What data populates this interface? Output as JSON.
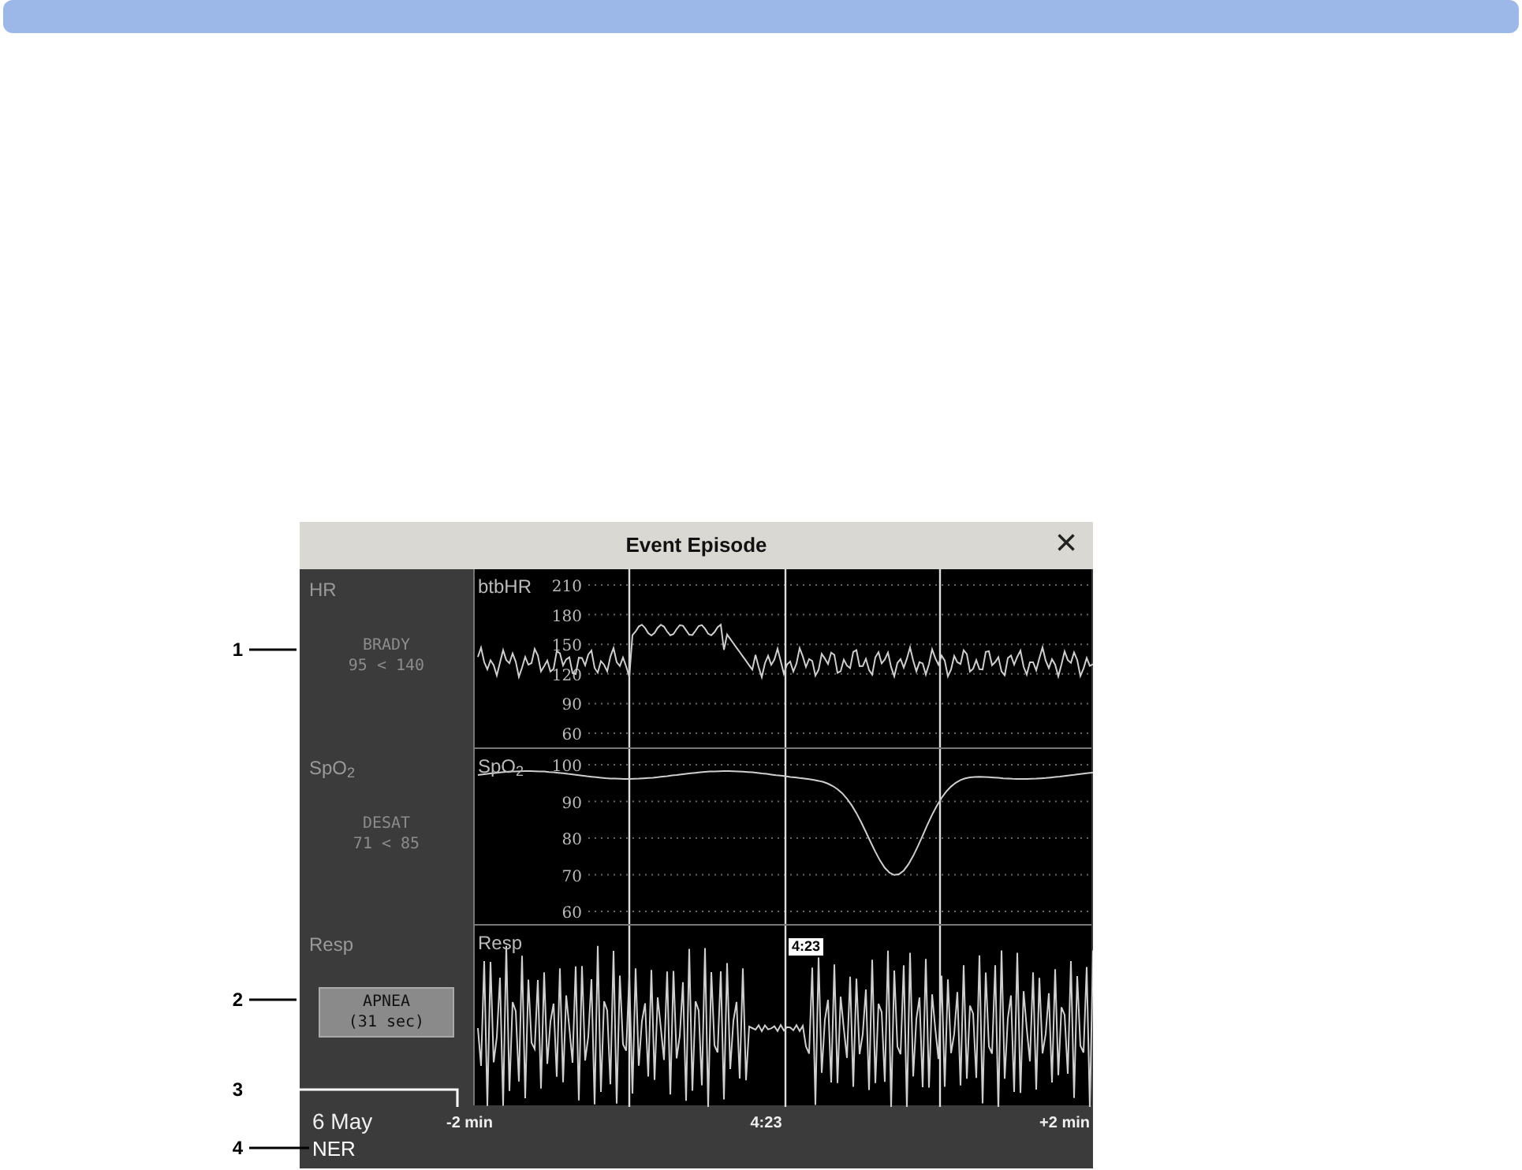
{
  "window": {
    "title": "Event Episode",
    "close": "×"
  },
  "panels": [
    {
      "kind": "hr",
      "name": "HR",
      "alarm": "BRADY",
      "limits": "95 < 140",
      "wave_label": "btbHR",
      "ticks": [
        "210",
        "180",
        "150",
        "120",
        "90",
        "60"
      ],
      "highlighted": false
    },
    {
      "kind": "spo2",
      "name": "SpO$_{2}$",
      "alarm": "DESAT",
      "limits": "71 < 85",
      "wave_label": "SpO$_{2}$",
      "ticks": [
        "100",
        "90",
        "80",
        "70",
        "60"
      ],
      "highlighted": false
    },
    {
      "kind": "resp",
      "name": "Resp",
      "alarm": "APNEA",
      "limits": "(31 sec)",
      "wave_label": "Resp",
      "highlighted": true
    }
  ],
  "marker": "4:23",
  "footer": {
    "date": "6 May",
    "mode": "NER",
    "x_start": "-2 min",
    "x_mid": "4:23",
    "x_end": "+2 min"
  },
  "callouts": [
    "1",
    "2",
    "3",
    "4"
  ]
}
